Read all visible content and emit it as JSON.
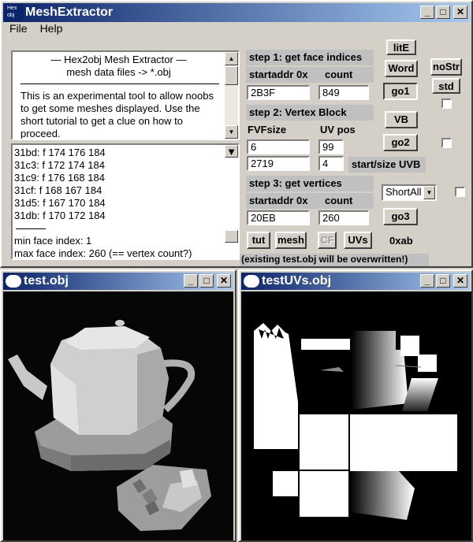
{
  "main_window": {
    "title": "MeshExtractor",
    "icon_text": "Hex obj",
    "menus": [
      "File",
      "Help"
    ]
  },
  "intro": {
    "heading": "—    Hex2obj Mesh Extractor    —",
    "subheading": "mesh data files -> *.obj",
    "body": "This is an experimental tool to allow noobs to get some meshes displayed. Use the short tutorial to get a clue on how to proceed."
  },
  "log": {
    "lines": [
      "31bd: f  174 176 184",
      "31c3: f  172 174 184",
      "31c9: f  176 168 184",
      "31cf: f  168 167 184",
      "31d5: f  167 170 184",
      "31db: f  170 172 184"
    ],
    "min_face": "min face index: 1",
    "max_face": "max face index: 260 (== vertex count?)"
  },
  "step1": {
    "label": "step 1: get face indices",
    "startaddr_label": "startaddr 0x",
    "count_label": "count",
    "startaddr_value": "2B3F",
    "count_value": "849"
  },
  "step2": {
    "label": "step 2: Vertex Block",
    "fvf_label": "FVFsize",
    "uvpos_label": "UV pos",
    "fvf_value": "6",
    "uvpos_value": "99",
    "uvb_start_value": "2719",
    "uvb_size_value": "4",
    "uvb_label": "start/size UVB"
  },
  "step3": {
    "label": "step 3: get vertices",
    "startaddr_label": "startaddr 0x",
    "count_label": "count",
    "startaddr_value": "20EB",
    "count_value": "260"
  },
  "buttons": {
    "lite": "litE",
    "word": "Word",
    "go1": "go1",
    "vb": "VB",
    "go2": "go2",
    "go3": "go3",
    "nostr": "noStr",
    "std": "std",
    "tut": "tut",
    "mesh": "mesh",
    "cf": "CF",
    "uvs": "UVs",
    "hex": "0xab"
  },
  "combo_value": "ShortAll",
  "warning": "(existing test.obj will be overwritten!)",
  "viewer_left": {
    "title": "test.obj"
  },
  "viewer_right": {
    "title": "testUVs.obj"
  }
}
